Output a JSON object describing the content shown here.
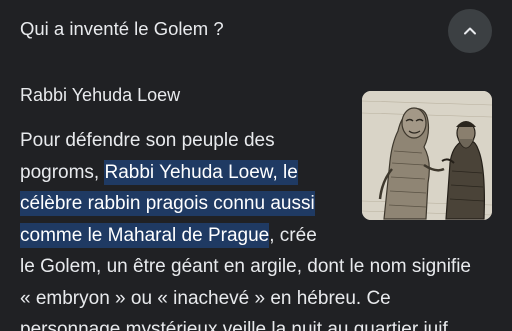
{
  "faq": {
    "question": "Qui a inventé le Golem ?"
  },
  "answer": {
    "title": "Rabbi Yehuda Loew",
    "lines": {
      "l1": "Pour défendre son peuple des",
      "l2a": "pogroms, ",
      "l2b": "Rabbi Yehuda Loew, le",
      "l3": "célèbre rabbin pragois connu aussi",
      "l4a": "comme le Maharal de Prague",
      "l4b": ", crée",
      "l5": "le Golem, un être géant en argile, dont le nom signifie",
      "l6": "« embryon » ou « inachevé » en hébreu. Ce",
      "l7": "personnage mystérieux veille la nuit au quartier juif."
    }
  },
  "icons": {
    "collapse": "chevron-up-icon"
  },
  "colors": {
    "background": "#202124",
    "text": "#e8eaed",
    "highlight": "#1f3a63",
    "button": "#3c4043"
  }
}
